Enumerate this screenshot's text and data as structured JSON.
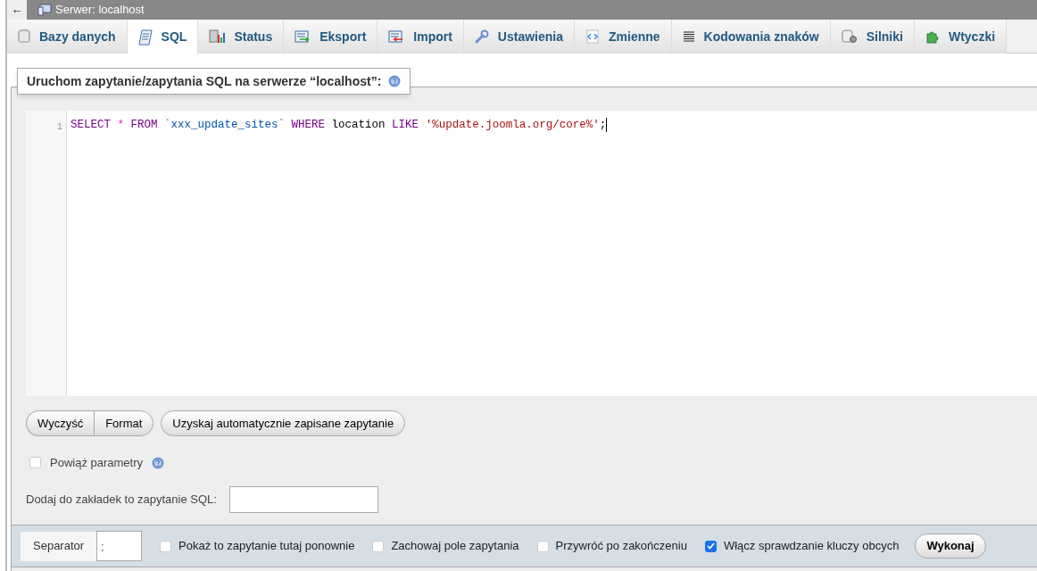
{
  "breadcrumb": {
    "back": "←",
    "title": "Serwer: localhost"
  },
  "tabs": [
    {
      "label": "Bazy danych",
      "selected": false
    },
    {
      "label": "SQL",
      "selected": true
    },
    {
      "label": "Status",
      "selected": false
    },
    {
      "label": "Eksport",
      "selected": false
    },
    {
      "label": "Import",
      "selected": false
    },
    {
      "label": "Ustawienia",
      "selected": false
    },
    {
      "label": "Zmienne",
      "selected": false
    },
    {
      "label": "Kodowania znaków",
      "selected": false
    },
    {
      "label": "Silniki",
      "selected": false
    },
    {
      "label": "Wtyczki",
      "selected": false
    }
  ],
  "legend": "Uruchom zapytanie/zapytania SQL na serwerze “localhost”:",
  "editor": {
    "lines": [
      {
        "number": "1",
        "tokens": [
          {
            "text": "SELECT",
            "kind": "keyword"
          },
          {
            "text": " *",
            "kind": "operator"
          },
          {
            "text": " FROM",
            "kind": "keyword"
          },
          {
            "text": " `xxx_update_sites`",
            "kind": "identifier"
          },
          {
            "text": " WHERE",
            "kind": "keyword"
          },
          {
            "text": " location",
            "kind": "plain"
          },
          {
            "text": " LIKE",
            "kind": "keyword"
          },
          {
            "text": " '%update.joomla.org/core%'",
            "kind": "string"
          },
          {
            "text": ";",
            "kind": "plain"
          }
        ]
      }
    ]
  },
  "editor_button_group": [
    "Wyczyść",
    "Format"
  ],
  "autosave_button": "Uzyskaj automatycznie zapisane zapytanie",
  "bind_parameters": {
    "label": "Powiąż parametry",
    "checked": false
  },
  "bookmark": {
    "label": "Dodaj do zakładek to zapytanie SQL:"
  },
  "footer": {
    "separator_label": "Separator",
    "separator_value": ";",
    "options": [
      {
        "label": "Pokaż to zapytanie tutaj ponownie",
        "checked": false
      },
      {
        "label": "Zachowaj pole zapytania",
        "checked": false
      },
      {
        "label": "Przywróć po zakończeniu",
        "checked": false
      },
      {
        "label": "Włącz sprawdzanie kluczy obcych",
        "checked": true
      }
    ],
    "submit": "Wykonaj"
  }
}
